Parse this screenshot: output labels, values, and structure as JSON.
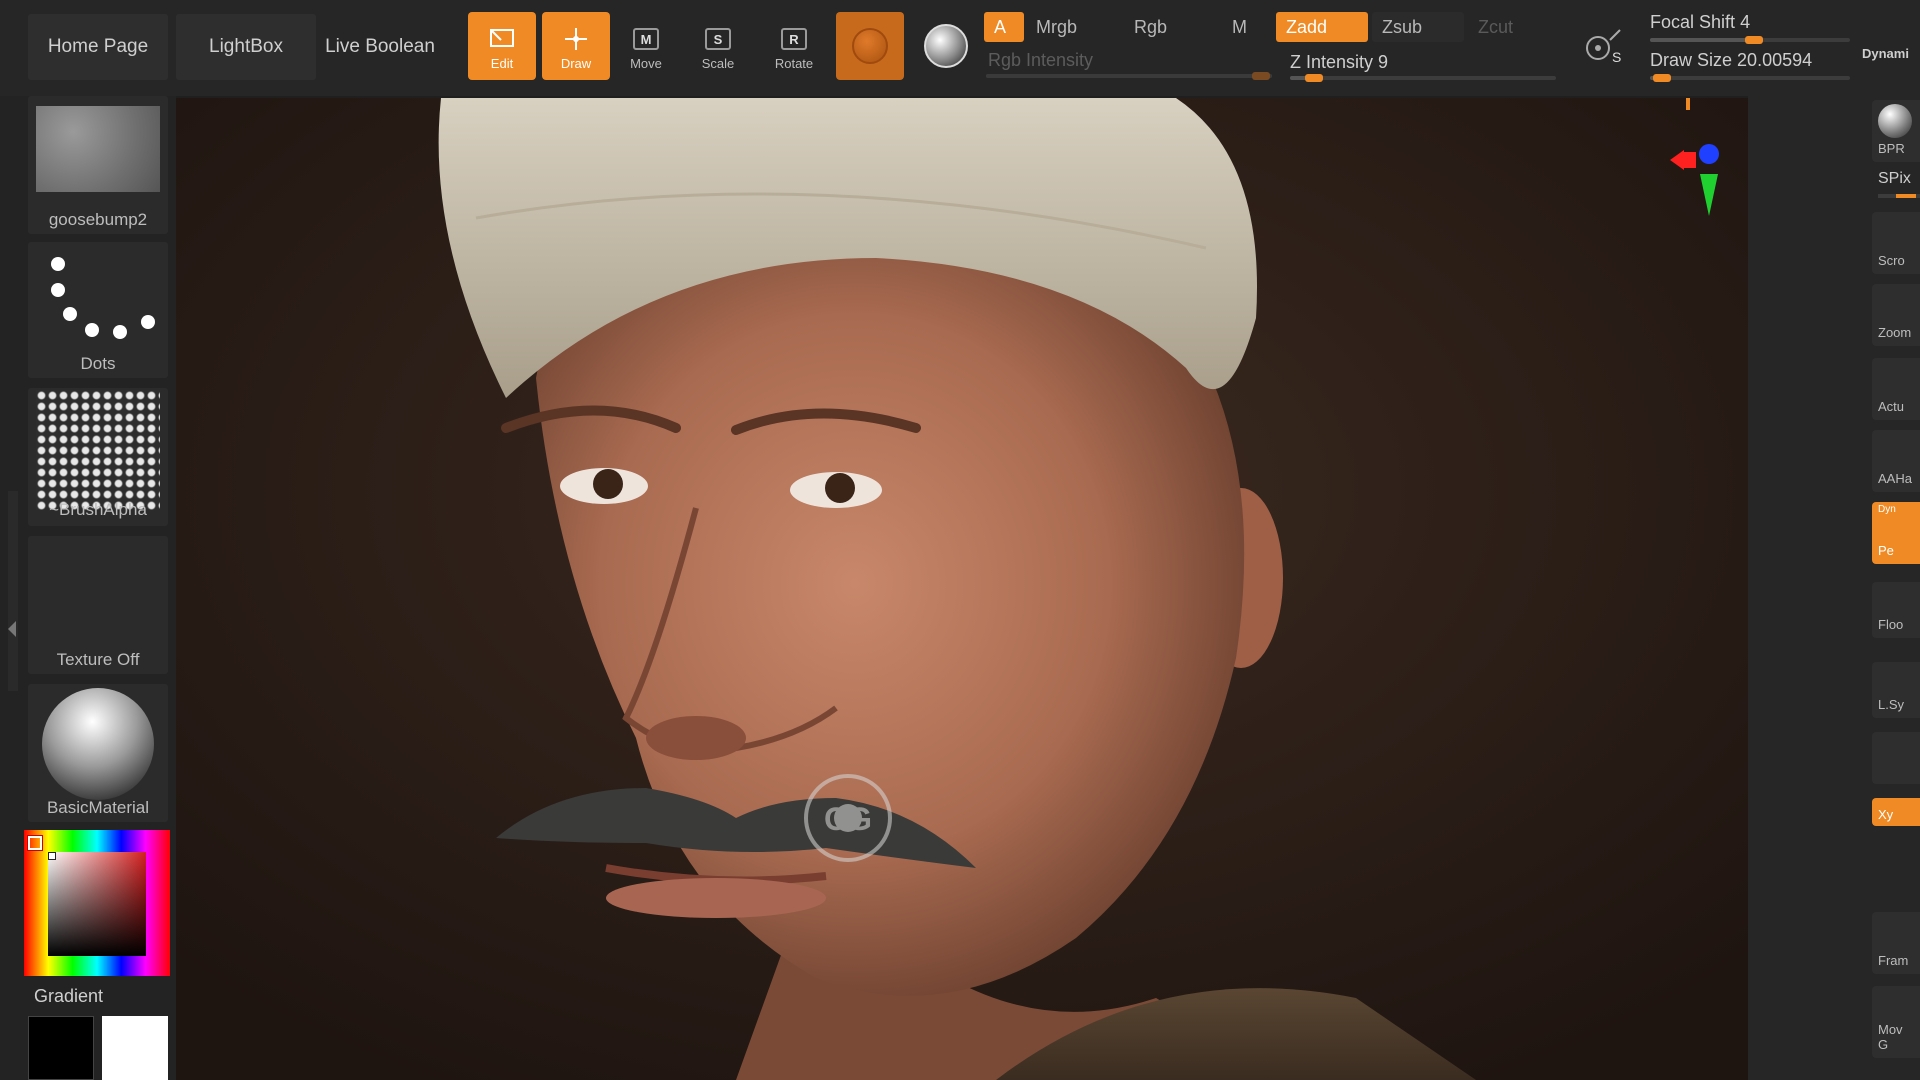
{
  "nav": {
    "home_page": "Home Page",
    "lightbox": "LightBox",
    "live_boolean": "Live Boolean"
  },
  "tools": {
    "edit": "Edit",
    "draw": "Draw",
    "move": "Move",
    "scale": "Scale",
    "rotate": "Rotate",
    "move_key": "M",
    "scale_key": "S",
    "rotate_key": "R"
  },
  "modes": {
    "a": "A",
    "mrgb": "Mrgb",
    "rgb": "Rgb",
    "m": "M",
    "zadd": "Zadd",
    "zsub": "Zsub",
    "zcut": "Zcut"
  },
  "sliders": {
    "rgb_intensity_label": "Rgb Intensity",
    "rgb_intensity_value": 100,
    "z_intensity_label": "Z Intensity",
    "z_intensity_value": "9",
    "z_intensity_fraction": 0.09,
    "focal_shift_label": "Focal Shift",
    "focal_shift_value": "4",
    "focal_shift_fraction": 0.52,
    "draw_size_label": "Draw Size",
    "draw_size_value": "20.00594",
    "draw_size_fraction": 0.06,
    "dynamic_label": "Dynami",
    "lazy_key": "S"
  },
  "left_shelf": {
    "alpha_name": "goosebump2",
    "stroke_name": "Dots",
    "brush_alpha_name": "~BrushAlpha",
    "texture_name": "Texture Off",
    "material_name": "BasicMaterial",
    "gradient_label": "Gradient"
  },
  "right_shelf": {
    "bpr": "BPR",
    "spix": "SPix",
    "scroll": "Scro",
    "zoom": "Zoom",
    "actual": "Actu",
    "aahalf": "AAHa",
    "persp": "Pe",
    "dynamic_small": "Dyn",
    "floor": "Floo",
    "lsym": "L.Sy",
    "xyz": "Xy",
    "frame": "Fram",
    "move": "Mov",
    "g": "G"
  },
  "watermark": "CG",
  "colors": {
    "accent": "#f08a24",
    "panel": "#262626",
    "button": "#2e2e2e",
    "canvas_bg": "#2b1e18"
  },
  "icons": {
    "edit": "edit-icon",
    "draw": "draw-icon",
    "material_sphere": "material-sphere-icon",
    "color_sphere": "color-sphere-icon",
    "lazy_mouse": "lazy-mouse-icon",
    "gyro": "gyro-axis-icon"
  }
}
